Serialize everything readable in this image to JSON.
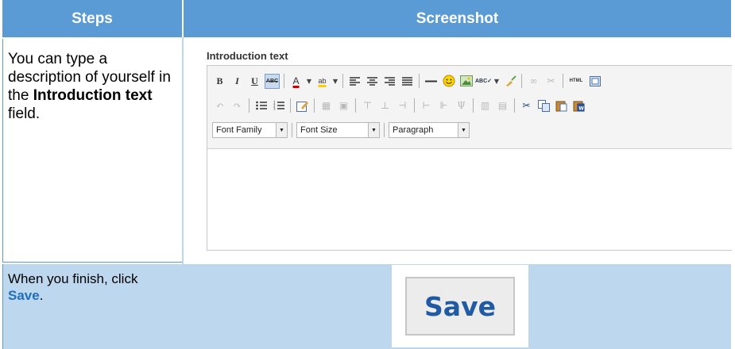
{
  "header": {
    "steps": "Steps",
    "screenshot": "Screenshot"
  },
  "rows": [
    {
      "step_prefix": "You can type a description of yourself in the",
      "step_bold": "Introduction text",
      "step_suffix": "field."
    },
    {
      "step_prefix": "When you finish, click",
      "step_link": "Save",
      "step_suffix": "."
    }
  ],
  "editor": {
    "label": "Introduction text",
    "font_family": "Font Family",
    "font_size": "Font Size",
    "paragraph": "Paragraph",
    "content": ""
  },
  "save_button": {
    "label": "Save"
  },
  "colors": {
    "header_bg": "#5b9bd5",
    "row_alt_bg": "#bcd7ee",
    "save_text": "#1f5aa3",
    "link": "#1f6fbf"
  }
}
